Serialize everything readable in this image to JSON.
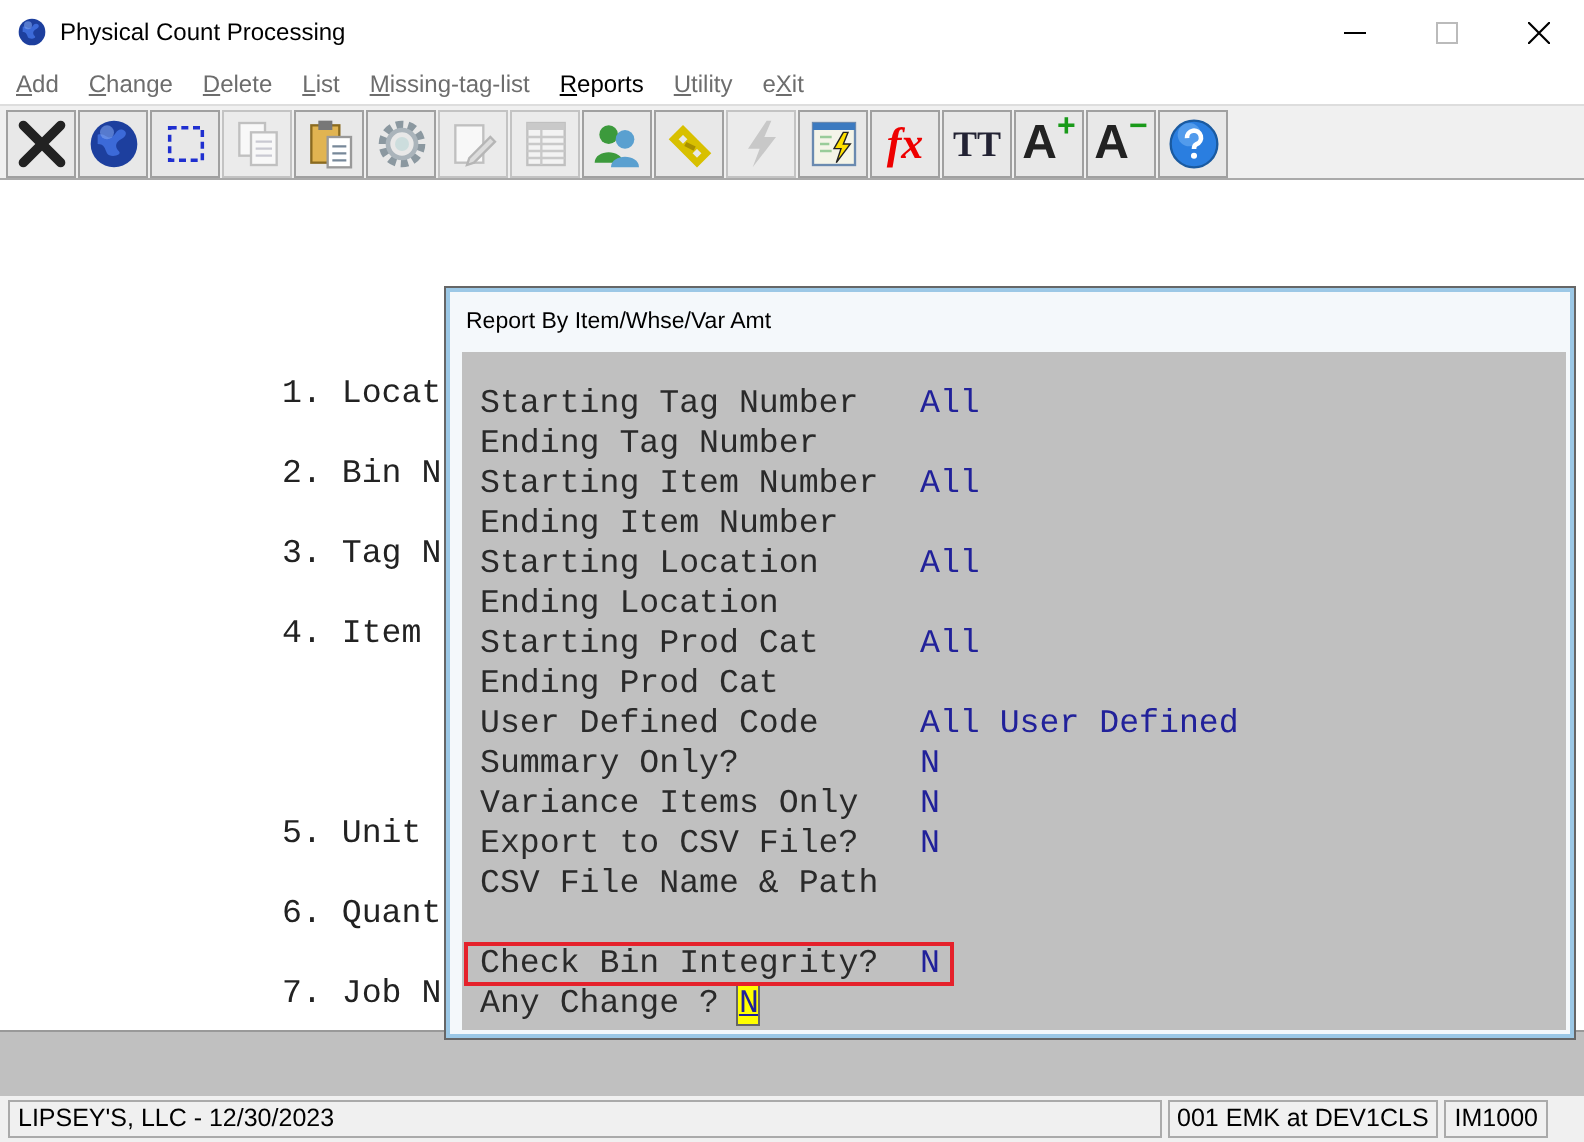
{
  "window": {
    "title": "Physical Count Processing"
  },
  "menu": [
    {
      "mnemonic": "A",
      "rest": "dd",
      "disabled": true
    },
    {
      "mnemonic": "C",
      "rest": "hange",
      "disabled": true
    },
    {
      "mnemonic": "D",
      "rest": "elete",
      "disabled": true
    },
    {
      "mnemonic": "L",
      "rest": "ist",
      "disabled": true
    },
    {
      "mnemonic": "M",
      "rest": "issing-tag-list",
      "disabled": true
    },
    {
      "mnemonic": "R",
      "rest": "eports",
      "disabled": false
    },
    {
      "mnemonic": "U",
      "rest": "tility",
      "disabled": true
    },
    {
      "prefix": "e",
      "mnemonic": "X",
      "rest": "it",
      "disabled": true
    }
  ],
  "toolbar": [
    {
      "kind": "close",
      "disabled": false
    },
    {
      "kind": "globe",
      "disabled": false
    },
    {
      "kind": "select",
      "disabled": false
    },
    {
      "kind": "copy",
      "disabled": true
    },
    {
      "kind": "paste",
      "disabled": false
    },
    {
      "kind": "gear",
      "disabled": false
    },
    {
      "kind": "edit",
      "disabled": true
    },
    {
      "kind": "table",
      "disabled": true
    },
    {
      "kind": "users",
      "disabled": false
    },
    {
      "kind": "link",
      "disabled": false
    },
    {
      "kind": "bolt",
      "disabled": true
    },
    {
      "kind": "window-bolt",
      "disabled": false
    },
    {
      "kind": "fx",
      "label": "fx",
      "disabled": false
    },
    {
      "kind": "tt",
      "label": "TT",
      "disabled": false
    },
    {
      "kind": "font-up",
      "label": "A",
      "sign": "+",
      "disabled": false
    },
    {
      "kind": "font-down",
      "label": "A",
      "sign": "−",
      "disabled": false
    },
    {
      "kind": "help",
      "disabled": false
    }
  ],
  "background_fields": [
    "1. Locat",
    "2. Bin N",
    "3. Tag N",
    "4. Item",
    "5. Unit",
    "6. Quant",
    "7. Job N"
  ],
  "dialog": {
    "title": "Report By Item/Whse/Var Amt",
    "fields": [
      {
        "label": "Starting Tag Number",
        "value": "All",
        "highlighted": false
      },
      {
        "label": "Ending Tag Number",
        "highlighted": false
      },
      {
        "label": "Starting Item Number",
        "value": "All",
        "highlighted": false
      },
      {
        "label": "Ending Item Number",
        "highlighted": false
      },
      {
        "label": "Starting Location",
        "value": "All",
        "highlighted": false
      },
      {
        "label": "Ending Location",
        "highlighted": false
      },
      {
        "label": "Starting Prod Cat",
        "value": "All",
        "highlighted": false
      },
      {
        "label": "Ending Prod Cat",
        "highlighted": false
      },
      {
        "label": "User Defined Code",
        "value": "All User Defined",
        "highlighted": false
      },
      {
        "label": "Summary Only?",
        "value": "N",
        "highlighted": false
      },
      {
        "label": "Variance Items Only",
        "value": "N",
        "highlighted": false
      },
      {
        "label": "Export to CSV File?",
        "value": "N",
        "highlighted": false
      },
      {
        "label": "CSV File Name & Path",
        "highlighted": false
      },
      {
        "label": "Check Bin Integrity?",
        "value": "N",
        "highlighted": true
      }
    ],
    "prompt": {
      "label": "Any Change ?",
      "value": "N"
    }
  },
  "status_bar": [
    "LIPSEY'S, LLC - 12/30/2023",
    "001 EMK at DEV1CLS",
    "IM1000"
  ]
}
